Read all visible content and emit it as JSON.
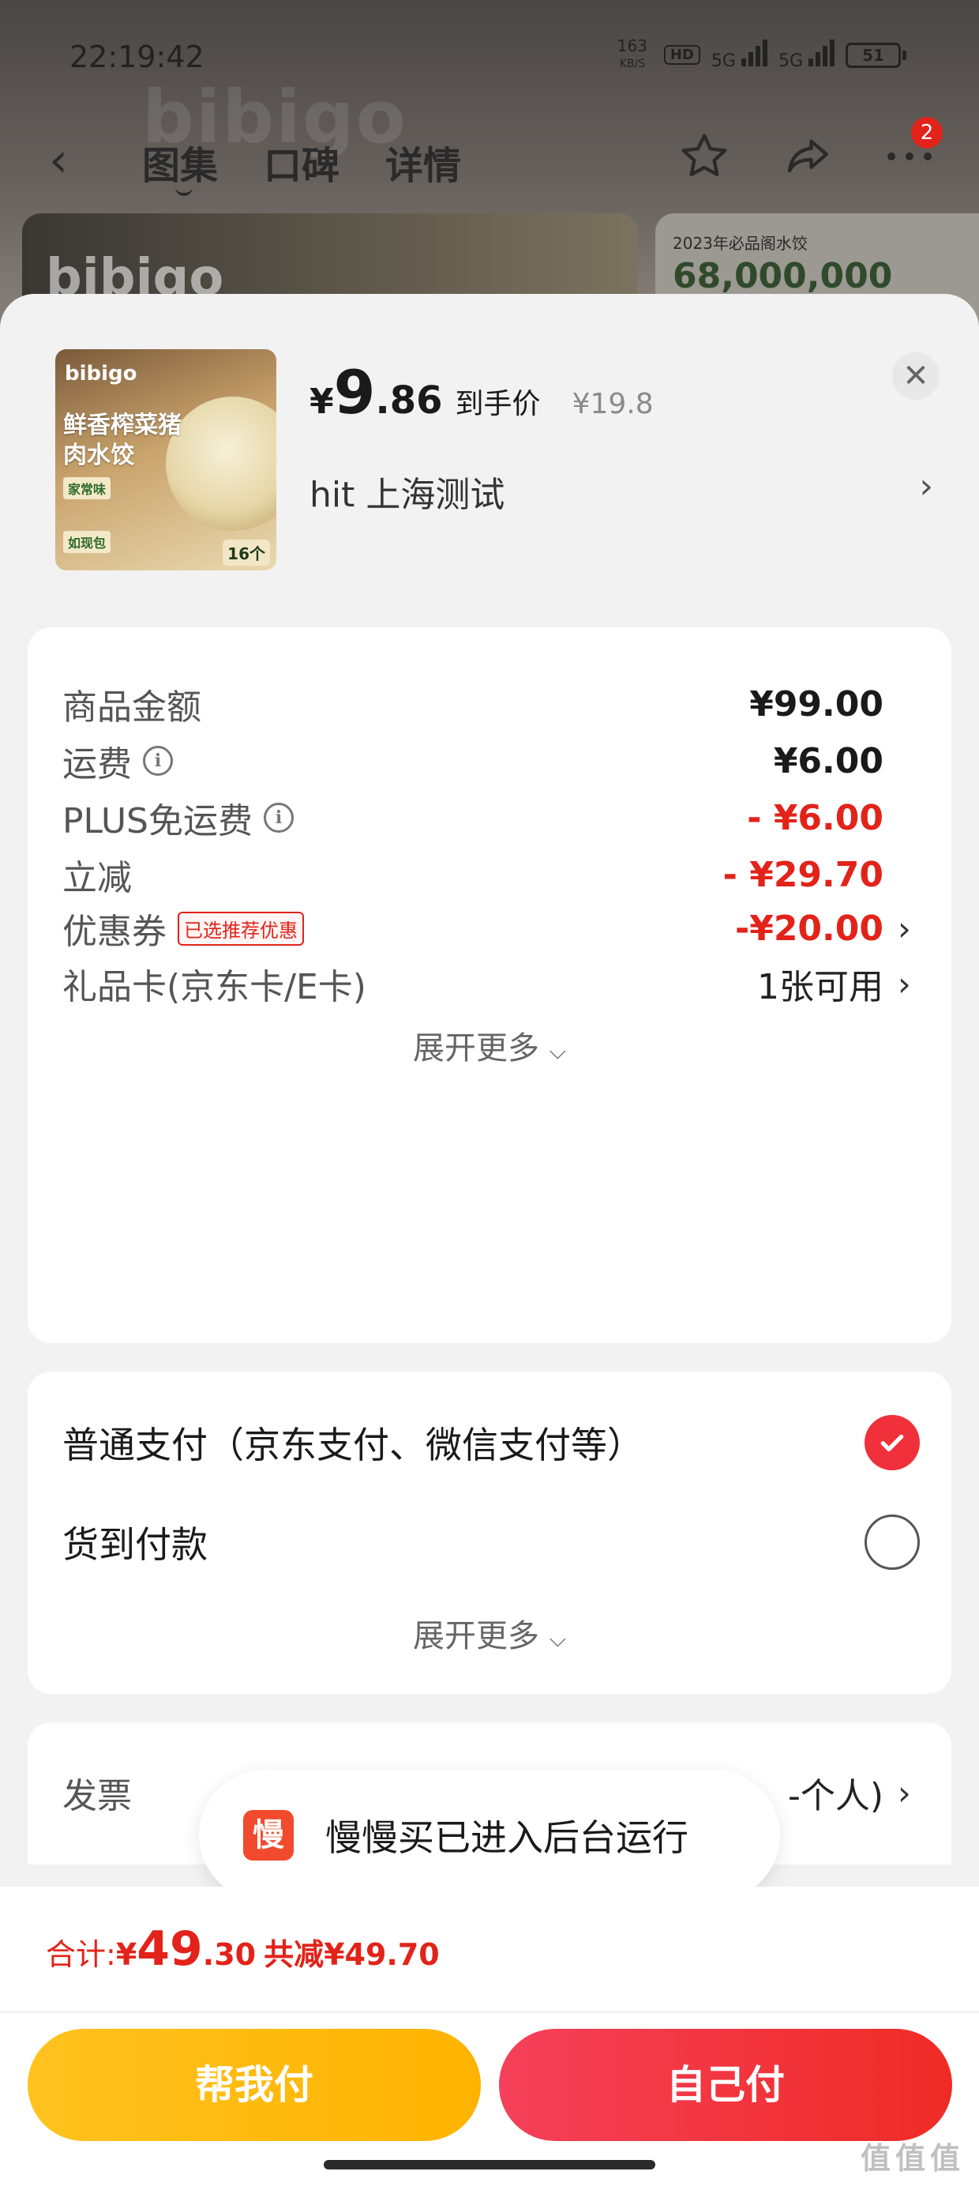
{
  "status_bar": {
    "time": "22:19:42",
    "net_speed_value": "163",
    "net_speed_unit": "KB/S",
    "hd_label": "HD",
    "net1": "5G",
    "net2": "5G",
    "battery": "51"
  },
  "nav": {
    "tabs": [
      "图集",
      "口碑",
      "详情"
    ],
    "active_tab": "图集",
    "more_badge": "2"
  },
  "background": {
    "brand_watermark": "bibigo",
    "banner_line1": "2023年必品阁水饺",
    "banner_line2": "68,000,000"
  },
  "product": {
    "thumb_brand": "bibigo",
    "thumb_title": "鲜香榨菜猪肉水饺",
    "thumb_tag1": "家常味",
    "thumb_tag2": "如现包",
    "thumb_count": "16个",
    "price_symbol": "¥",
    "price_int": "9",
    "price_dec": ".86",
    "price_label": "到手价",
    "original_price": "¥19.8",
    "spec": "hit  上海测试"
  },
  "fees": {
    "rows": [
      {
        "label": "商品金额",
        "value": "¥99.00"
      },
      {
        "label": "运费",
        "value": "¥6.00"
      },
      {
        "label": "PLUS免运费",
        "value": "- ¥6.00"
      },
      {
        "label": "立减",
        "value": "- ¥29.70"
      },
      {
        "label": "优惠券",
        "tag": "已选推荐优惠",
        "value": "-¥20.00"
      },
      {
        "label": "礼品卡(京东卡/E卡)",
        "value": "1张可用"
      }
    ],
    "more": "展开更多"
  },
  "payment": {
    "options": [
      {
        "label": "普通支付（京东支付、微信支付等）",
        "selected": true
      },
      {
        "label": "货到付款",
        "selected": false
      }
    ],
    "more": "展开更多"
  },
  "invoice": {
    "label": "发票",
    "value": "-个人)"
  },
  "toast": {
    "app_glyph": "慢",
    "message": "慢慢买已进入后台运行"
  },
  "footer": {
    "total_label": "合计:",
    "total_symbol": "¥",
    "total_int": "49",
    "total_dec": ".30",
    "saved": "共减¥49.70",
    "help_pay": "帮我付",
    "self_pay": "自己付"
  },
  "watermark": "值值值",
  "colors": {
    "accent_red": "#e2231a",
    "help_button": "#ffb300",
    "self_button": "#ef2b25"
  }
}
